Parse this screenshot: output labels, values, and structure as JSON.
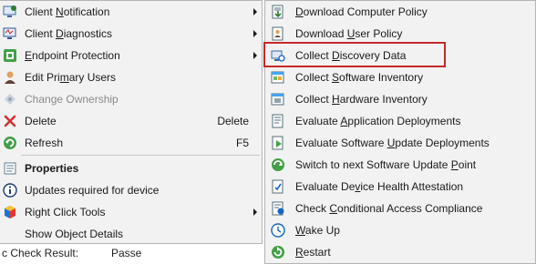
{
  "left_menu": {
    "items": [
      {
        "label_pre": "Client ",
        "label_u": "N",
        "label_post": "otification",
        "icon": "client-notification-icon",
        "submenu": true
      },
      {
        "label_pre": "Client ",
        "label_u": "D",
        "label_post": "iagnostics",
        "icon": "client-diagnostics-icon",
        "submenu": true
      },
      {
        "label_pre": "",
        "label_u": "E",
        "label_post": "ndpoint Protection",
        "icon": "endpoint-protection-icon",
        "submenu": true
      },
      {
        "label_pre": "Edit Pri",
        "label_u": "m",
        "label_post": "ary Users",
        "icon": "users-icon"
      },
      {
        "label_pre": "Change Ownership",
        "label_u": "",
        "label_post": "",
        "icon": "ownership-icon",
        "disabled": true
      },
      {
        "label_pre": "Delete",
        "label_u": "",
        "label_post": "",
        "icon": "delete-icon",
        "shortcut": "Delete"
      },
      {
        "label_pre": "Refresh",
        "label_u": "",
        "label_post": "",
        "icon": "refresh-icon",
        "shortcut": "F5"
      },
      {
        "label_pre": "Properties",
        "label_u": "",
        "label_post": "",
        "icon": "properties-icon",
        "bold": true
      },
      {
        "label_pre": "Updates required for device",
        "label_u": "",
        "label_post": "",
        "icon": "info-icon"
      },
      {
        "label_pre": "Right Click Tools",
        "label_u": "",
        "label_post": "",
        "icon": "right-click-tools-icon",
        "submenu": true
      },
      {
        "label_pre": "Show Object Details",
        "label_u": "",
        "label_post": "",
        "icon": ""
      }
    ]
  },
  "right_menu": {
    "items": [
      {
        "label_pre": "",
        "label_u": "D",
        "label_post": "ownload Computer Policy",
        "icon": "policy-download-icon"
      },
      {
        "label_pre": "Download ",
        "label_u": "U",
        "label_post": "ser Policy",
        "icon": "user-policy-icon"
      },
      {
        "label_pre": "Collect ",
        "label_u": "D",
        "label_post": "iscovery Data",
        "icon": "discovery-data-icon"
      },
      {
        "label_pre": "Collect ",
        "label_u": "S",
        "label_post": "oftware Inventory",
        "icon": "software-inventory-icon"
      },
      {
        "label_pre": "Collect ",
        "label_u": "H",
        "label_post": "ardware Inventory",
        "icon": "hardware-inventory-icon"
      },
      {
        "label_pre": "Evaluate ",
        "label_u": "A",
        "label_post": "pplication Deployments",
        "icon": "app-deployment-icon"
      },
      {
        "label_pre": "Evaluate Software ",
        "label_u": "U",
        "label_post": "pdate Deployments",
        "icon": "update-deployment-icon"
      },
      {
        "label_pre": "Switch to next Software Update ",
        "label_u": "P",
        "label_post": "oint",
        "icon": "switch-point-icon"
      },
      {
        "label_pre": "Evaluate De",
        "label_u": "v",
        "label_post": "ice Health Attestation",
        "icon": "health-attestation-icon"
      },
      {
        "label_pre": "Check ",
        "label_u": "C",
        "label_post": "onditional Access Compliance",
        "icon": "compliance-icon"
      },
      {
        "label_pre": "",
        "label_u": "W",
        "label_post": "ake Up",
        "icon": "wake-up-icon"
      },
      {
        "label_pre": "",
        "label_u": "R",
        "label_post": "estart",
        "icon": "restart-icon"
      }
    ]
  },
  "background": {
    "field_label": "c Check Result:",
    "field_value": "Passe"
  },
  "colors": {
    "menu_bg": "#f2f2f2",
    "highlight_border": "#c62828"
  }
}
